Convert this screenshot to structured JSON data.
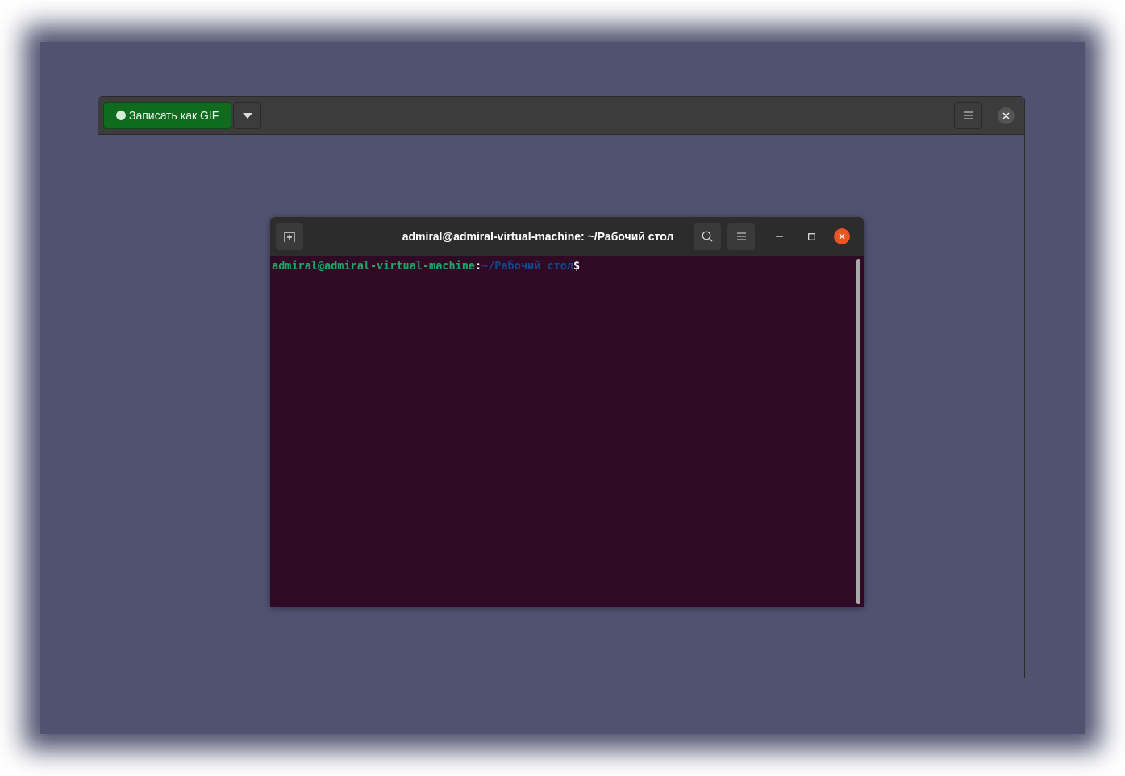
{
  "recorder": {
    "record_button": "Записать как GIF"
  },
  "terminal": {
    "title": "admiral@admiral-virtual-machine: ~/Рабочий стол",
    "prompt": [
      {
        "kind": "user",
        "text": "admiral@admiral-virtual-machine"
      },
      {
        "kind": "plain",
        "text": ":"
      },
      {
        "kind": "path",
        "text": "~/Рабочий стол"
      },
      {
        "kind": "plain",
        "text": "$"
      }
    ]
  }
}
